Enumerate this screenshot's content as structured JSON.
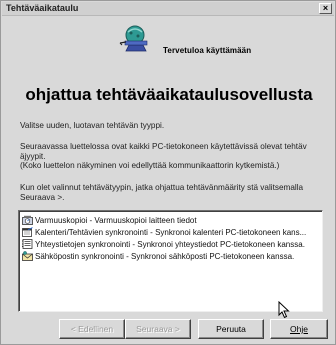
{
  "window": {
    "title": "Tehtäväaikataulu",
    "close_glyph": "×"
  },
  "header": {
    "welcome": "Tervetuloa käyttämään",
    "heading": "ohjattua tehtäväaikataulusovellusta",
    "icon": "wizard-icon"
  },
  "body": {
    "p1": "Valitse uuden, luotavan tehtävän tyyppi.",
    "p2": "Seuraavassa luettelossa ovat kaikki PC-tietokoneen käytettävissä olevat tehtäv äjyypit.\n(Koko luettelon näkyminen voi edellyttää kommunikaattorin kytkemistä.)",
    "p3": "Kun olet valinnut tehtävätyypin, jatka ohjattua tehtävänmäärity stä valitsemalla Seuraava >."
  },
  "task_list": [
    {
      "label": "Varmuuskopioi - Varmuuskopioi laitteen tiedot",
      "icon": "backup-icon"
    },
    {
      "label": "Kalenteri/Tehtävien synkronointi - Synkronoi kalenteri PC-tietokoneen kans...",
      "icon": "calendar-icon"
    },
    {
      "label": "Yhteystietojen synkronointi - Synkronoi yhteystiedot PC-tietokoneen kanssa.",
      "icon": "contacts-icon"
    },
    {
      "label": "Sähköpostin synkronointi - Synkronoi sähköposti PC-tietokoneen kanssa.",
      "icon": "email-icon"
    }
  ],
  "buttons": {
    "prev": "< Edellinen",
    "next": "Seuraava >",
    "cancel": "Peruuta",
    "help": "Ohje"
  },
  "colors": {
    "window_bg": "#d9d9d9",
    "list_bg": "#ffffff",
    "disabled_text": "#9a9a9a"
  }
}
